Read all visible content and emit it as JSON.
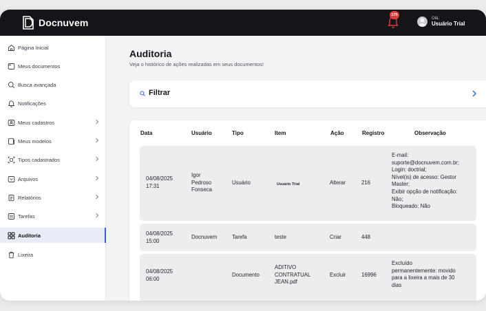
{
  "topbar": {
    "brand": "Docnuvem",
    "notifications_badge": "179",
    "user_greeting": "Olá,",
    "user_name": "Usuário Trial"
  },
  "sidebar": {
    "items": [
      {
        "label": "Página Inicial",
        "icon": "home-icon",
        "chevron": false,
        "active": false
      },
      {
        "label": "Meus documentos",
        "icon": "folder-icon",
        "chevron": false,
        "active": false
      },
      {
        "label": "Busca avançada",
        "icon": "search-icon",
        "chevron": false,
        "active": false
      },
      {
        "label": "Notificações",
        "icon": "bell-icon",
        "chevron": false,
        "active": false
      },
      {
        "label": "Meus cadastros",
        "icon": "id-card-icon",
        "chevron": true,
        "active": false
      },
      {
        "label": "Meus modelos",
        "icon": "template-icon",
        "chevron": true,
        "active": false
      },
      {
        "label": "Tipos cadastrados",
        "icon": "scan-icon",
        "chevron": true,
        "active": false
      },
      {
        "label": "Arquivos",
        "icon": "archive-icon",
        "chevron": true,
        "active": false
      },
      {
        "label": "Relatórios",
        "icon": "report-icon",
        "chevron": true,
        "active": false
      },
      {
        "label": "Tarefas",
        "icon": "tasks-icon",
        "chevron": true,
        "active": false
      },
      {
        "label": "Auditoria",
        "icon": "grid-icon",
        "chevron": false,
        "active": true
      },
      {
        "label": "Lixeira",
        "icon": "trash-icon",
        "chevron": false,
        "active": false
      }
    ]
  },
  "page": {
    "title": "Auditoria",
    "subtitle": "Veja o histórico de ações realizadas em seus documentos!"
  },
  "filter": {
    "label": "Filtrar"
  },
  "table": {
    "columns": [
      "Data",
      "Usuário",
      "Tipo",
      "Item",
      "Ação",
      "Registro",
      "Observação"
    ],
    "rows": [
      {
        "data": "04/08/2025\n17:31",
        "usuario": "Igor\nPedroso\nFonseca",
        "tipo": "Usuário",
        "item": "Usuário Trial",
        "acao": "Alterar",
        "registro": "216",
        "observacao": "E-mail:\nsuporte@docnuvem.com.br;\nLogin: doctrial;\nNível(is) de acesso: Gestor\nMaster;\nExibir opção de notificação:\nNão;\nBloqueado: Não"
      },
      {
        "data": "04/08/2025\n15:00",
        "usuario": "Docnuvem",
        "tipo": "Tarefa",
        "item": "teste",
        "acao": "Criar",
        "registro": "448",
        "observacao": ""
      },
      {
        "data": "04/08/2025\n06:00",
        "usuario": "",
        "tipo": "Documento",
        "item": "ADITIVO\nCONTRATUAL\nJEAN.pdf",
        "acao": "Excluir",
        "registro": "16996",
        "observacao": "Excluído\npermanentemente: movido\npara a lixeira a mais de 30\ndias"
      }
    ]
  },
  "colors": {
    "topbar": "#141419",
    "accent": "#2f5fd7",
    "badge": "#e23b3b",
    "row": "#ededf0"
  }
}
